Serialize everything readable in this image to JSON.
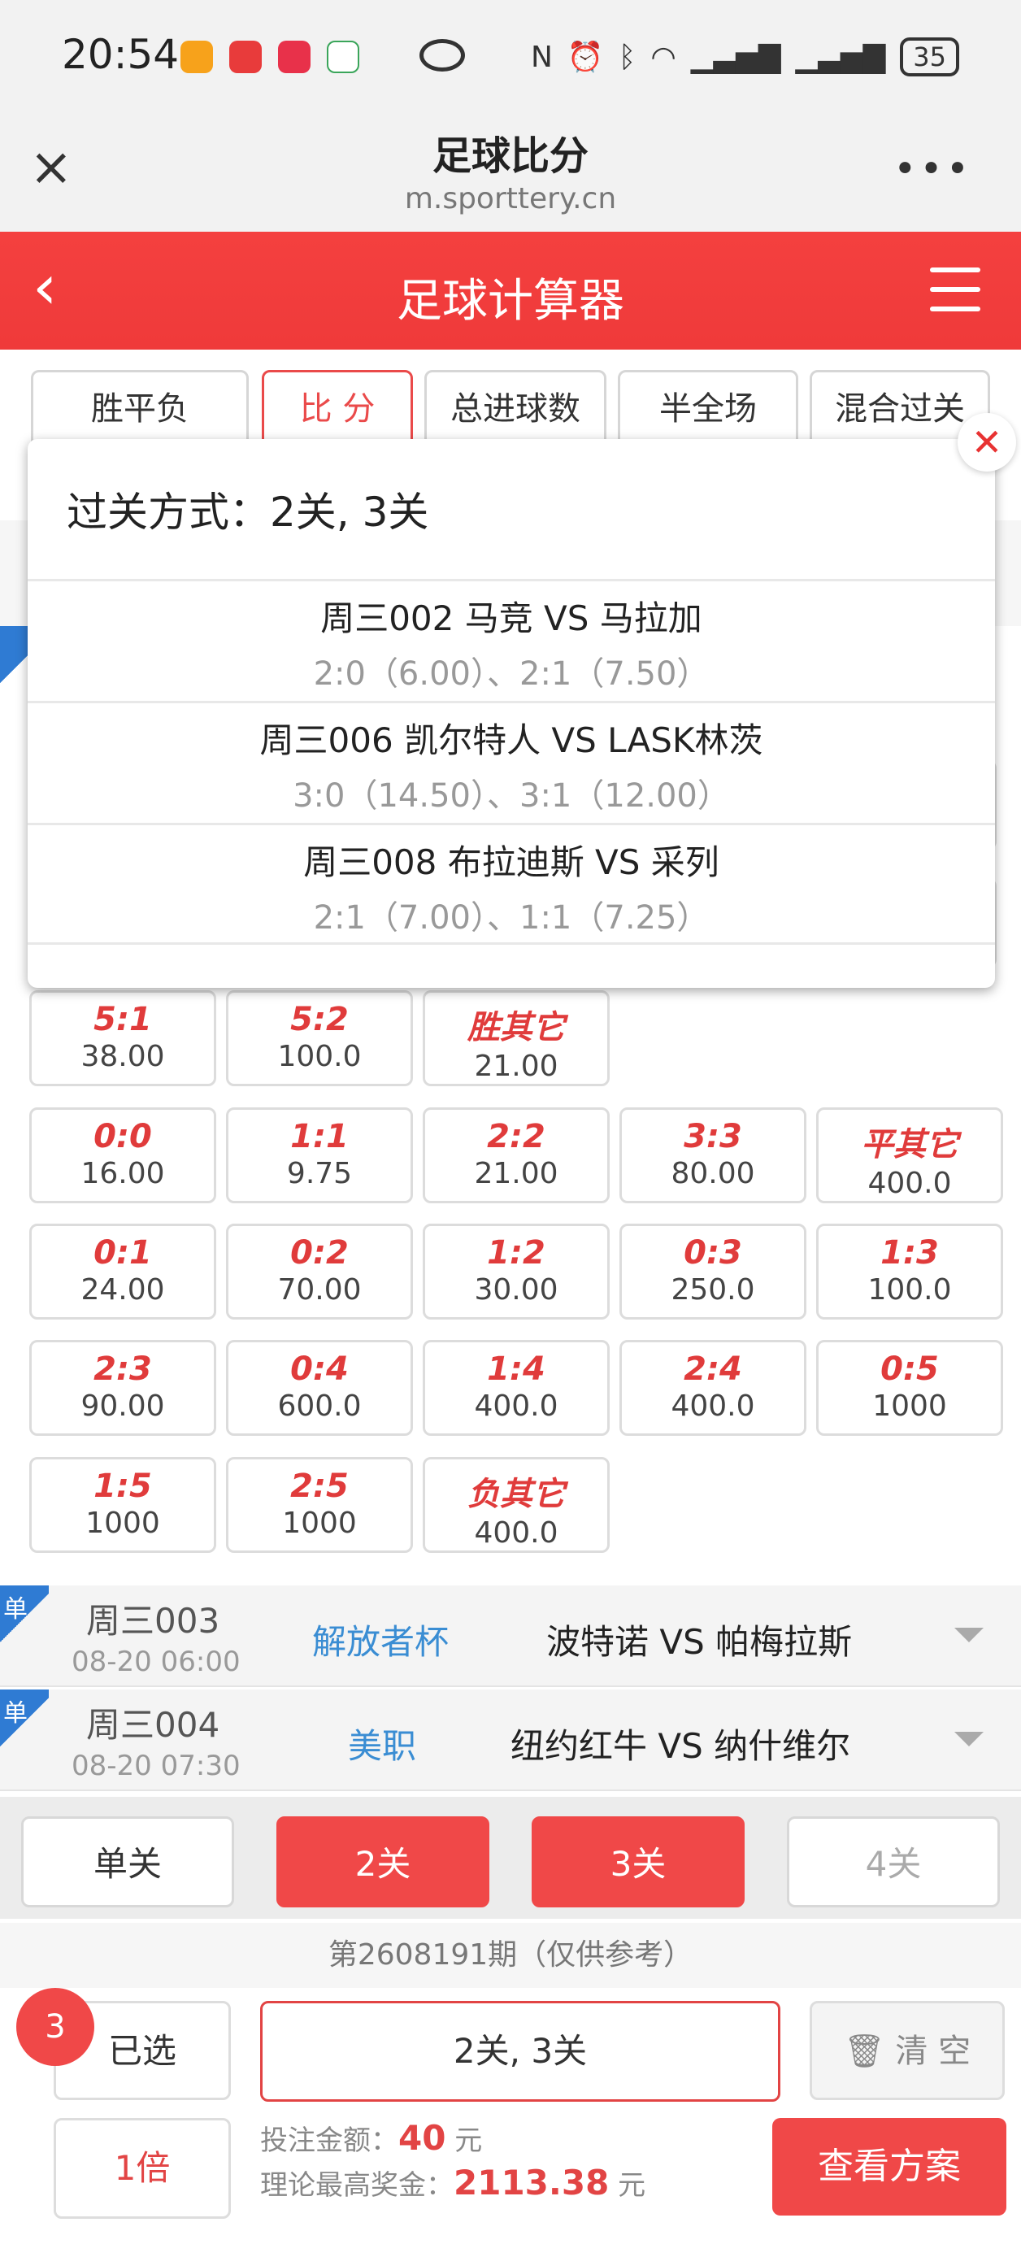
{
  "status": {
    "time": "20:54",
    "battery": "35"
  },
  "browser": {
    "title": "足球比分",
    "url": "m.sporttery.cn",
    "close": "×",
    "more": "•••"
  },
  "header": {
    "back": "‹",
    "title": "足球计算器"
  },
  "tabs": [
    {
      "label": "胜平负"
    },
    {
      "label": "比 分"
    },
    {
      "label": "总进球数"
    },
    {
      "label": "半全场"
    },
    {
      "label": "混合过关"
    }
  ],
  "popup": {
    "title": "过关方式：2关, 3关",
    "matches": [
      {
        "match": "周三002 马竞 VS 马拉加",
        "picks": "2:0（6.00）、2:1（7.50）"
      },
      {
        "match": "周三006 凯尔特人 VS LASK林茨",
        "picks": "3:0（14.50）、3:1（12.00）"
      },
      {
        "match": "周三008 布拉迪斯 VS 采列",
        "picks": "2:1（7.00）、1:1（7.25）"
      }
    ]
  },
  "grid": [
    [
      {
        "score": "5:1",
        "odds": "38.00"
      },
      {
        "score": "5:2",
        "odds": "100.0"
      },
      {
        "score": "胜其它",
        "odds": "21.00"
      }
    ],
    [
      {
        "score": "0:0",
        "odds": "16.00"
      },
      {
        "score": "1:1",
        "odds": "9.75"
      },
      {
        "score": "2:2",
        "odds": "21.00"
      },
      {
        "score": "3:3",
        "odds": "80.00"
      },
      {
        "score": "平其它",
        "odds": "400.0"
      }
    ],
    [
      {
        "score": "0:1",
        "odds": "24.00"
      },
      {
        "score": "0:2",
        "odds": "70.00"
      },
      {
        "score": "1:2",
        "odds": "30.00"
      },
      {
        "score": "0:3",
        "odds": "250.0"
      },
      {
        "score": "1:3",
        "odds": "100.0"
      }
    ],
    [
      {
        "score": "2:3",
        "odds": "90.00"
      },
      {
        "score": "0:4",
        "odds": "600.0"
      },
      {
        "score": "1:4",
        "odds": "400.0"
      },
      {
        "score": "2:4",
        "odds": "400.0"
      },
      {
        "score": "0:5",
        "odds": "1000"
      }
    ],
    [
      {
        "score": "1:5",
        "odds": "1000"
      },
      {
        "score": "2:5",
        "odds": "1000"
      },
      {
        "score": "负其它",
        "odds": "400.0"
      }
    ]
  ],
  "matches": [
    {
      "badge": "单",
      "week": "周三003",
      "date": "08-20 06:00",
      "league": "解放者杯",
      "teams": "波特诺  VS  帕梅拉斯"
    },
    {
      "badge": "单",
      "week": "周三004",
      "date": "08-20 07:30",
      "league": "美职",
      "teams": "纽约红牛  VS  纳什维尔"
    }
  ],
  "pass_buttons": [
    {
      "label": "单关",
      "state": "off"
    },
    {
      "label": "2关",
      "state": "on"
    },
    {
      "label": "3关",
      "state": "on"
    },
    {
      "label": "4关",
      "state": "dim"
    }
  ],
  "period": "第2608191期（仅供参考）",
  "bottom": {
    "count": "3",
    "selected_label": "已选",
    "mode": "2关, 3关",
    "clear": "清 空",
    "multiplier": "1倍",
    "bet_label": "投注金额：",
    "bet_value": "40",
    "bet_unit": "元",
    "max_label": "理论最高奖金：",
    "max_value": "2113.38",
    "max_unit": "元",
    "view": "查看方案"
  },
  "colors": {
    "accent": "#f04848",
    "league": "#3a8dd3"
  }
}
